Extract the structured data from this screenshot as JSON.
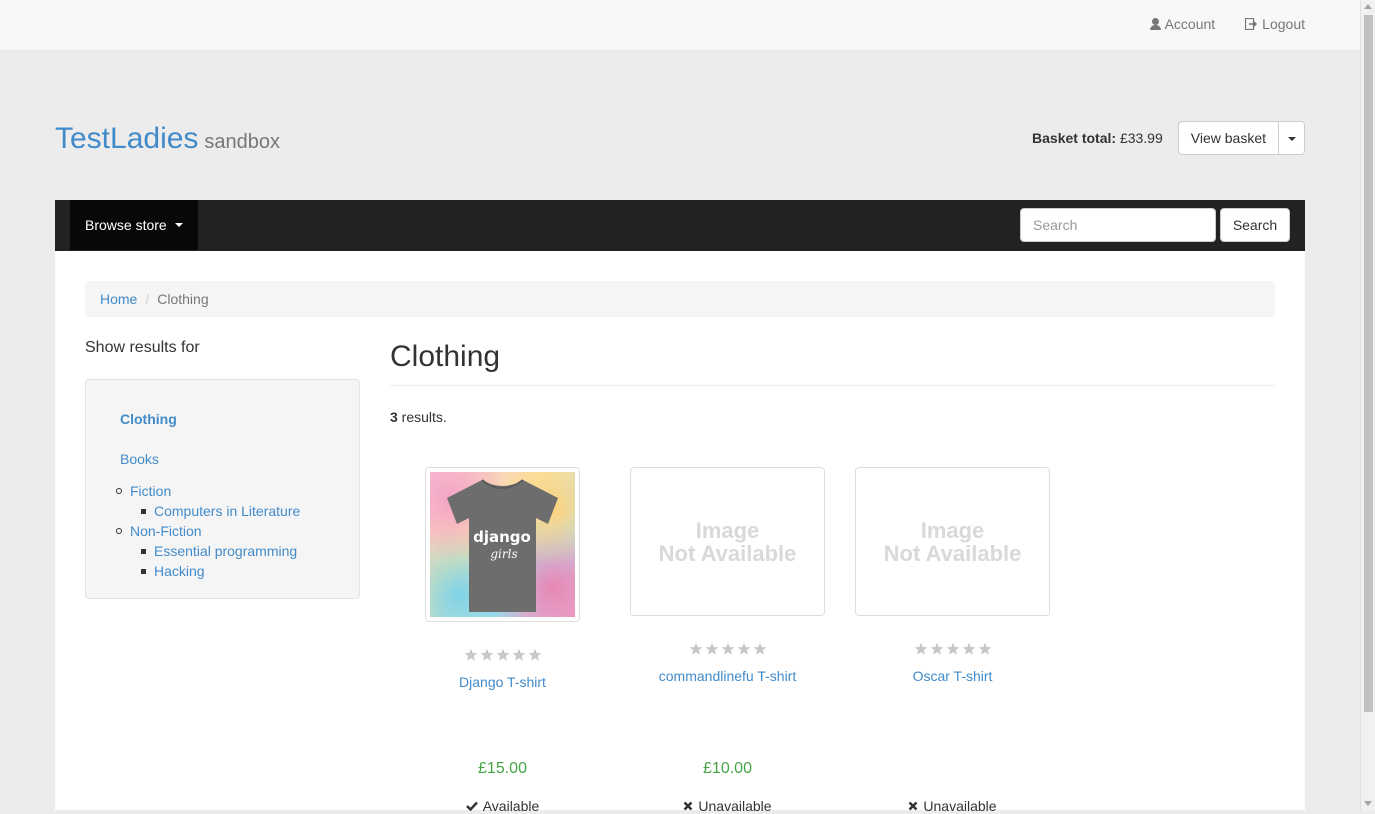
{
  "topbar": {
    "account_label": "Account",
    "logout_label": "Logout"
  },
  "brand": {
    "name": "TestLadies",
    "subtitle": "sandbox"
  },
  "basket": {
    "total_label": "Basket total:",
    "total_value": "£33.99",
    "view_label": "View basket"
  },
  "navbar": {
    "browse_label": "Browse store",
    "search_placeholder": "Search",
    "search_button": "Search"
  },
  "breadcrumb": {
    "home": "Home",
    "current": "Clothing"
  },
  "sidebar": {
    "title": "Show results for",
    "active_category": "Clothing",
    "books": "Books",
    "fiction": "Fiction",
    "computers_in_literature": "Computers in Literature",
    "non_fiction": "Non-Fiction",
    "essential_programming": "Essential programming",
    "hacking": "Hacking"
  },
  "main": {
    "title": "Clothing",
    "results_count": "3",
    "results_suffix": " results."
  },
  "image_not_available": {
    "line1": "Image",
    "line2": "Not Available"
  },
  "products": [
    {
      "name": "Django T-shirt",
      "price": "£15.00",
      "availability": "Available",
      "rating": 0,
      "image_text_1": "django",
      "image_text_2": "girls"
    },
    {
      "name": "commandlinefu T-shirt",
      "price": "£10.00",
      "availability": "Unavailable",
      "rating": 0
    },
    {
      "name": "Oscar T-shirt",
      "availability": "Unavailable",
      "rating": 0
    }
  ],
  "colors": {
    "link": "#428bca",
    "price": "#47a447",
    "navbar": "#222222",
    "star_empty": "#c8c8c8"
  }
}
